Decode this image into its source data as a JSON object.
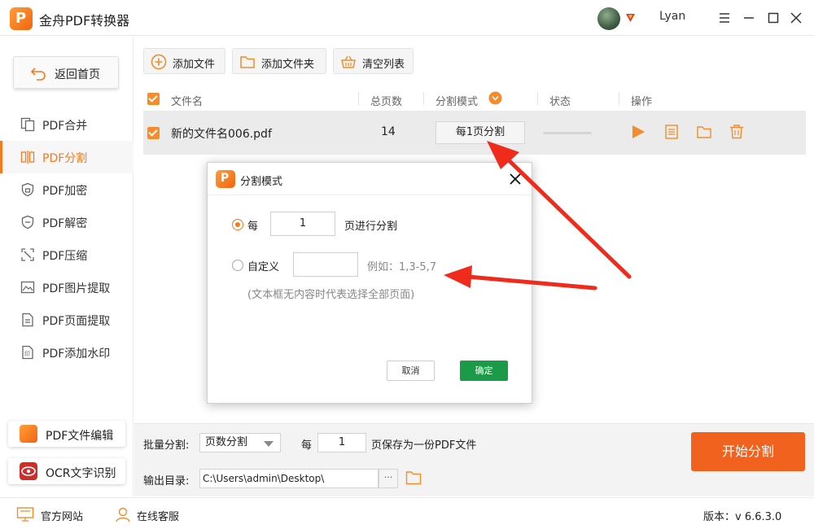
{
  "app": {
    "title": "金舟PDF转换器",
    "username": "Lyan"
  },
  "sidebar": {
    "back_label": "返回首页",
    "items": [
      {
        "label": "PDF合并",
        "active": false
      },
      {
        "label": "PDF分割",
        "active": true
      },
      {
        "label": "PDF加密",
        "active": false
      },
      {
        "label": "PDF解密",
        "active": false
      },
      {
        "label": "PDF压缩",
        "active": false
      },
      {
        "label": "PDF图片提取",
        "active": false
      },
      {
        "label": "PDF页面提取",
        "active": false
      },
      {
        "label": "PDF添加水印",
        "active": false
      }
    ],
    "tools": [
      {
        "label": "PDF文件编辑"
      },
      {
        "label": "OCR文字识别"
      }
    ]
  },
  "toolbar": {
    "add_file": "添加文件",
    "add_folder": "添加文件夹",
    "clear_list": "清空列表"
  },
  "table": {
    "headers": {
      "filename": "文件名",
      "pages": "总页数",
      "mode": "分割模式",
      "status": "状态",
      "action": "操作"
    },
    "rows": [
      {
        "filename": "新的文件名006.pdf",
        "pages": "14",
        "mode": "每1页分割",
        "progress": 0
      }
    ]
  },
  "bottom": {
    "batch_label": "批量分割:",
    "batch_mode": "页数分割",
    "per_label": "每",
    "per_value": "1",
    "per_suffix": "页保存为一份PDF文件",
    "output_label": "输出目录:",
    "output_path": "C:\\Users\\admin\\Desktop\\",
    "browse": "···",
    "start": "开始分割"
  },
  "footer": {
    "website": "官方网站",
    "support": "在线客服",
    "version": "版本：v 6.6.3.0"
  },
  "modal": {
    "title": "分割模式",
    "option_every_label": "每",
    "option_every_value": "1",
    "option_every_suffix": "页进行分割",
    "option_custom_label": "自定义",
    "option_custom_value": "",
    "example": "例如：1,3-5,7",
    "note": "(文本框无内容时代表选择全部页面)",
    "cancel": "取消",
    "ok": "确定"
  },
  "colors": {
    "accent": "#f47920",
    "start_button": "#f2621f",
    "ok_button": "#1b9b48",
    "arrow": "#ef2b1c"
  },
  "icons": [
    "back-arrow-icon",
    "merge-icon",
    "split-icon",
    "lock-icon",
    "unlock-shield-icon",
    "compress-icon",
    "image-icon",
    "page-icon",
    "watermark-icon",
    "add-icon",
    "folder-icon",
    "basket-icon",
    "play-icon",
    "doc-icon",
    "trash-icon",
    "close-icon",
    "chevron-down-icon",
    "website-icon",
    "support-icon"
  ]
}
